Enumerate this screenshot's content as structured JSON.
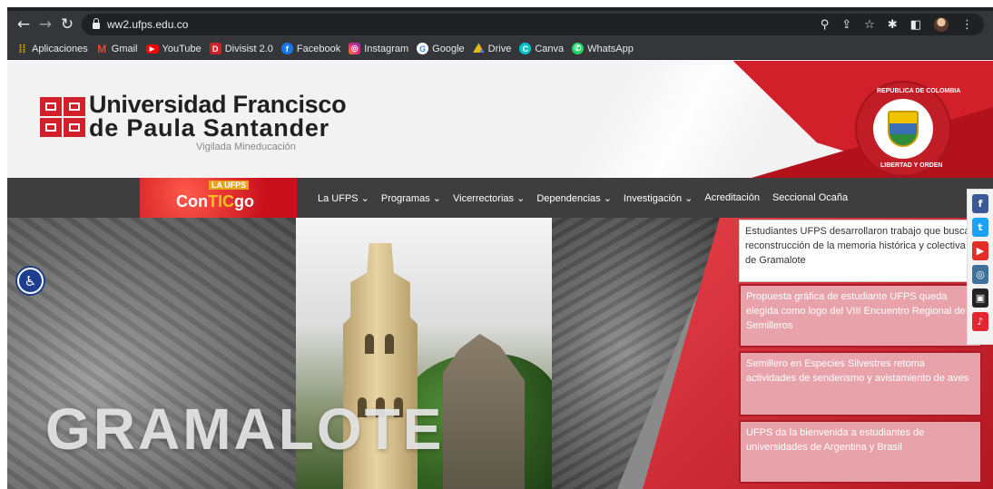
{
  "browser": {
    "url": "ww2.ufps.edu.co",
    "bookmarks": [
      {
        "label": "Aplicaciones",
        "icon": "apps-grid-icon",
        "color": "#f4b400"
      },
      {
        "label": "Gmail",
        "icon": "gmail-icon",
        "color": "#ea4335"
      },
      {
        "label": "YouTube",
        "icon": "youtube-icon",
        "color": "#ff0000"
      },
      {
        "label": "Divisist 2.0",
        "icon": "divisist-icon",
        "color": "#d1202a"
      },
      {
        "label": "Facebook",
        "icon": "facebook-icon",
        "color": "#1877f2"
      },
      {
        "label": "Instagram",
        "icon": "instagram-icon",
        "color": "#e1306c"
      },
      {
        "label": "Google",
        "icon": "google-icon",
        "color": "#4285f4"
      },
      {
        "label": "Drive",
        "icon": "drive-icon",
        "color": "#0f9d58"
      },
      {
        "label": "Canva",
        "icon": "canva-icon",
        "color": "#00c4cc"
      },
      {
        "label": "WhatsApp",
        "icon": "whatsapp-icon",
        "color": "#25d366"
      }
    ]
  },
  "site": {
    "name_line1": "Universidad Francisco",
    "name_line2": "de Paula Santander",
    "tagline": "Vigilada Mineducación",
    "seal_text_top": "REPUBLICA DE COLOMBIA",
    "seal_text_bottom": "LIBERTAD Y ORDEN",
    "brand_color": "#d1202a",
    "campaign": {
      "tag": "LA UFPS",
      "pre": "Con",
      "mid": "TIC",
      "post": "go"
    },
    "nav": [
      {
        "label": "La UFPS ⌄"
      },
      {
        "label": "Programas ⌄"
      },
      {
        "label": "Vicerrectorias ⌄"
      },
      {
        "label": "Dependencias ⌄"
      },
      {
        "label": "Investigación ⌄"
      },
      {
        "label": "Acreditación"
      },
      {
        "label": "Seccional Ocaña"
      }
    ],
    "hero_title": "GRAMALOTE",
    "news": [
      {
        "text": "Estudiantes UFPS desarrollaron trabajo que busca reconstrucción de la memoria histórica y colectiva de Gramalote",
        "active": true
      },
      {
        "text": "Propuesta gráfica de estudiante UFPS queda elegida como logo del VIII Encuentro Regional de Semilleros",
        "active": false
      },
      {
        "text": "Semillero en Especies Silvestres retoma actividades de senderismo y avistamiento de aves",
        "active": false
      },
      {
        "text": "UFPS da la bienvenida a estudiantes de universidades de Argentina y Brasil",
        "active": false
      }
    ],
    "social": [
      {
        "icon": "facebook-icon",
        "glyph": "f",
        "color": "#3b5998"
      },
      {
        "icon": "twitter-icon",
        "glyph": "t",
        "color": "#1da1f2"
      },
      {
        "icon": "youtube-icon",
        "glyph": "▶",
        "color": "#e52d27"
      },
      {
        "icon": "instagram-icon",
        "glyph": "◎",
        "color": "#3f729b"
      },
      {
        "icon": "radio-icon",
        "glyph": "▣",
        "color": "#222222"
      },
      {
        "icon": "tiktok-icon",
        "glyph": "♪",
        "color": "#e4252f"
      }
    ]
  }
}
